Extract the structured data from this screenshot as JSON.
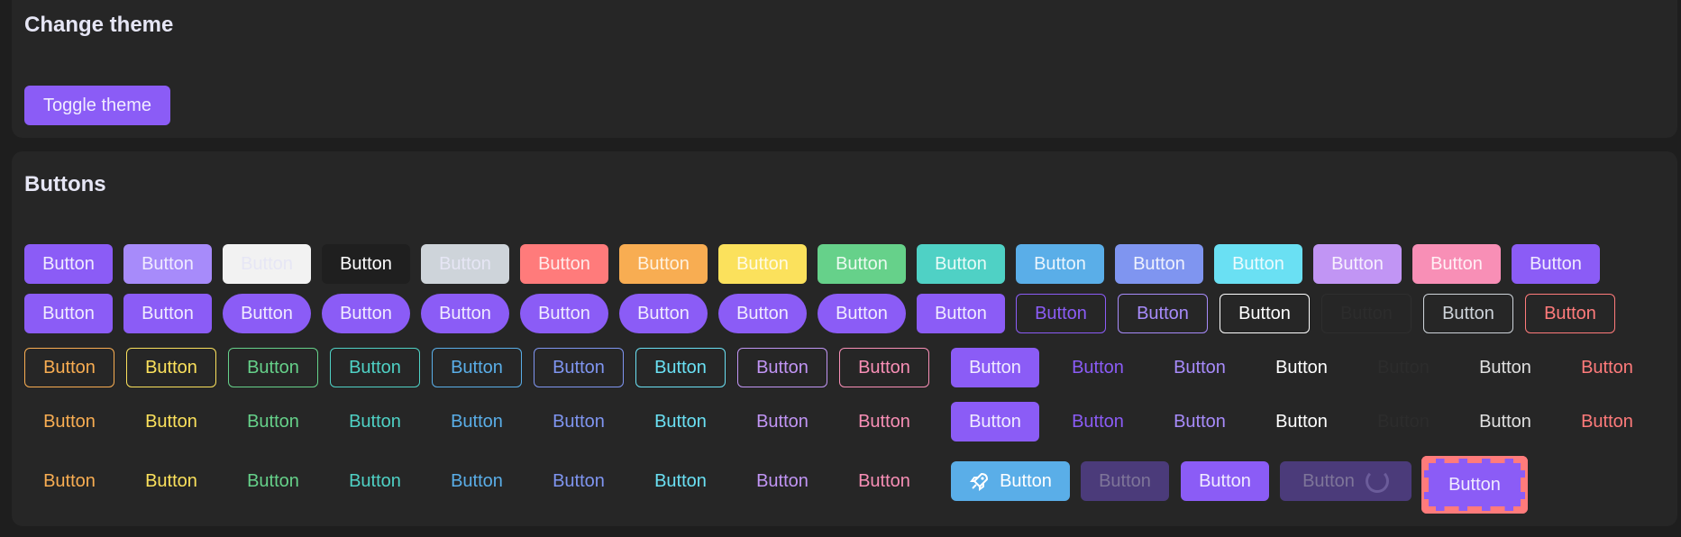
{
  "theme_card": {
    "title": "Change theme",
    "toggle_label": "Toggle theme"
  },
  "buttons_card": {
    "title": "Buttons",
    "label": "Button"
  },
  "colors": {
    "primary": "#8b5cf6",
    "secondary": "#a78bfa",
    "light": "#f2f2f2",
    "dark": "#1f1f1f",
    "gray": "#ced4da",
    "red": "#ff7b7b",
    "orange": "#f8ad52",
    "yellow": "#fbe15c",
    "green": "#66d18a",
    "teal": "#4fd1c5",
    "blue": "#5aaee8",
    "indigo": "#7f95f0",
    "cyan": "#6ae0f3",
    "purple": "#c195f4",
    "pink": "#f88fb6"
  },
  "rows": [
    {
      "row": 1,
      "style": "solid",
      "variants": [
        "primary",
        "secondary",
        "light",
        "dark",
        "gray",
        "red",
        "orange",
        "yellow",
        "green",
        "teal",
        "blue",
        "indigo",
        "cyan",
        "purple",
        "pink",
        "primary"
      ]
    },
    {
      "row": 2,
      "style": "mixed",
      "variants": [
        "primary",
        "primary",
        "pill-primary",
        "pill-primary",
        "pill-primary",
        "pill-primary",
        "pill-primary",
        "pill-primary",
        "pill-primary",
        "primary",
        "outline-primary",
        "outline-secondary",
        "outline-light",
        "outline-dark",
        "outline-gray",
        "outline-red"
      ]
    },
    {
      "row": 3,
      "style": "outline+ghost",
      "variants": [
        "outline-orange",
        "outline-yellow",
        "outline-green",
        "outline-teal",
        "outline-blue",
        "outline-indigo",
        "outline-cyan",
        "outline-purple",
        "outline-pink",
        "solid-primary",
        "ghost-primary",
        "ghost-secondary",
        "ghost-light",
        "ghost-dark",
        "ghost-gray",
        "ghost-red"
      ]
    },
    {
      "row": 4,
      "style": "ghost",
      "variants": [
        "orange",
        "yellow",
        "green",
        "teal",
        "blue",
        "indigo",
        "cyan",
        "purple",
        "pink",
        "solid-primary",
        "primary",
        "secondary",
        "light",
        "dark",
        "gray",
        "red"
      ]
    },
    {
      "row": 5,
      "style": "ghost+states",
      "variants": [
        "orange",
        "yellow",
        "green",
        "teal",
        "blue",
        "indigo",
        "cyan",
        "purple",
        "pink",
        "icon-rocket",
        "disabled",
        "primary",
        "loading",
        "dashed"
      ]
    }
  ]
}
